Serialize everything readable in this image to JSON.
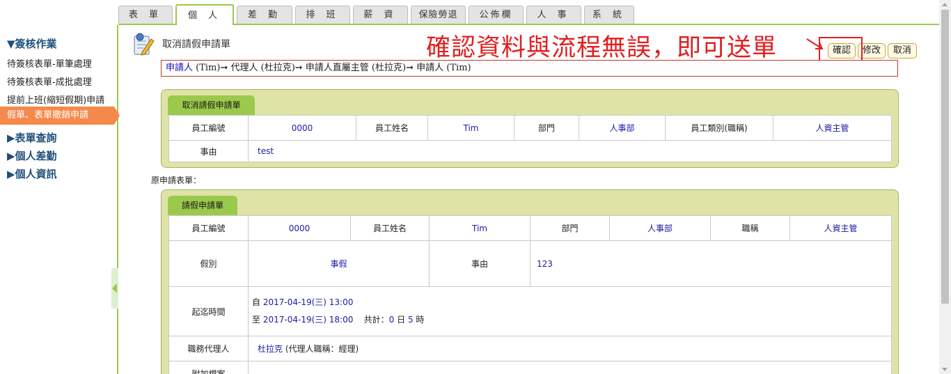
{
  "tabs": [
    "表 單",
    "個 人",
    "差 勤",
    "排 班",
    "薪 資",
    "保險勞退",
    "公佈欄",
    "人 事",
    "系 統"
  ],
  "sidebar": {
    "section1": "▼簽核作業",
    "items": [
      "待簽核表單-單筆處理",
      "待簽核表單-成批處理",
      "提前上班(縮短假期)申請",
      "假單、表單撤銷申請"
    ],
    "section2": "▶表單查詢",
    "section3": "▶個人差勤",
    "section4": "▶個人資訊"
  },
  "header": {
    "title": "取消請假申請單",
    "note": "確認資料與流程無誤，即可送單",
    "buttons": {
      "confirm": "確認",
      "modify": "修改",
      "cancel": "取消"
    }
  },
  "flow": {
    "p1": "申請人",
    "p1b": " (Tim)",
    "arrow": "➞ ",
    "p2": "代理人 (杜拉克)",
    "p3": "申請人直屬主管 (杜拉克)",
    "p4": "申請人 (Tim)"
  },
  "cancel_form": {
    "tab": "取消請假申請單",
    "labels": {
      "emp_no": "員工編號",
      "emp_name": "員工姓名",
      "dept": "部門",
      "emp_type": "員工類別(職稱)",
      "reason": "事由"
    },
    "values": {
      "emp_no": "0000",
      "emp_name": "Tim",
      "dept": "人事部",
      "emp_type": "人資主管",
      "reason": "test"
    }
  },
  "orig_label": "原申請表單：",
  "leave_form": {
    "tab": "請假申請單",
    "labels": {
      "emp_no": "員工編號",
      "emp_name": "員工姓名",
      "dept": "部門",
      "title": "職稱",
      "leave_type": "假別",
      "reason": "事由",
      "period": "起迄時間",
      "agent": "職務代理人",
      "attach": "附加檔案"
    },
    "values": {
      "emp_no": "0000",
      "emp_name": "Tim",
      "dept": "人事部",
      "title": "人資主管",
      "leave_type": "事假",
      "reason": "123",
      "from_prefix": "自",
      "from": "2017-04-19(三) 13:00",
      "to_prefix": "至",
      "to": "2017-04-19(三) 18:00",
      "total_label": "共計：",
      "days": "0",
      "day_unit": "日",
      "hours": "5",
      "hour_unit": "時",
      "agent": "杜拉克",
      "agent_note": "(代理人職稱：經理)"
    }
  },
  "colors": {
    "accent_green": "#9bc94b",
    "active_orange": "#f4894b",
    "note_red": "#e01f1f"
  }
}
